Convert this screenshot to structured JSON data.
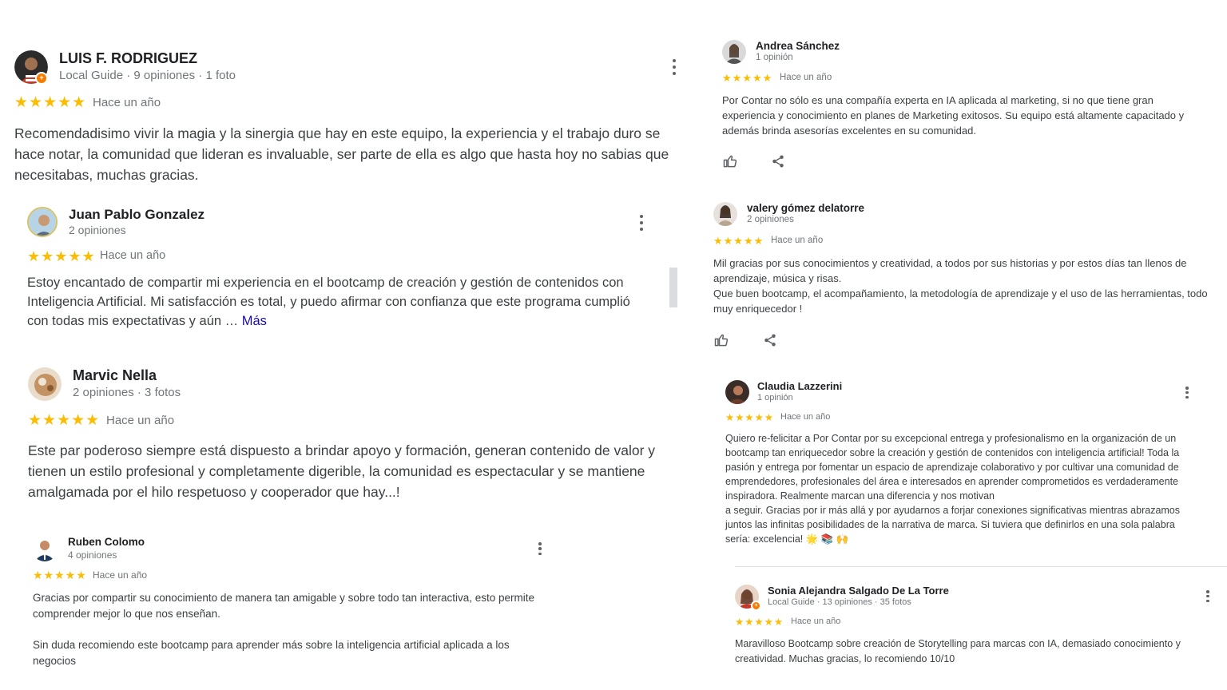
{
  "colors": {
    "star": "#fbbc04",
    "meta": "#70757a",
    "link": "#1a0dab",
    "badge": "#f57c00"
  },
  "icons": {
    "kebab": "more-vert-icon",
    "like": "thumb-up-icon",
    "share": "share-icon",
    "star": "star-icon",
    "local_guide": "local-guide-badge-icon"
  },
  "reviews": [
    {
      "author": "LUIS F. RODRIGUEZ",
      "meta": "Local Guide · 9 opiniones · 1 foto",
      "stars": "★★★★★",
      "rating": 5,
      "time": "Hace un año",
      "text": "Recomendadisimo vivir la magia y la sinergia que hay en este equipo, la experiencia y el trabajo duro se hace notar, la comunidad que lideran es invaluable, ser parte de ella es algo que hasta hoy no sabias que necesitabas, muchas gracias."
    },
    {
      "author": "Juan Pablo Gonzalez",
      "meta": "2 opiniones",
      "stars": "★★★★★",
      "rating": 5,
      "time": "Hace un año",
      "text": "Estoy encantado de compartir mi experiencia en el bootcamp de creación y gestión de contenidos con Inteligencia Artificial. Mi satisfacción es total, y puedo afirmar con confianza que este programa cumplió con todas mis expectativas y aún …",
      "more": "Más"
    },
    {
      "author": "Marvic Nella",
      "meta": "2 opiniones · 3 fotos",
      "stars": "★★★★★",
      "rating": 5,
      "time": "Hace un año",
      "text": "Este par poderoso siempre está dispuesto a brindar apoyo y formación, generan contenido de valor y tienen un estilo profesional y completamente digerible, la comunidad es espectacular y se mantiene amalgamada por el hilo respetuoso y cooperador que hay...!"
    },
    {
      "author": "Ruben Colomo",
      "meta": "4 opiniones",
      "stars": "★★★★★",
      "rating": 5,
      "time": "Hace un año",
      "text": "Gracias por compartir su conocimiento de manera tan amigable y sobre todo tan interactiva, esto permite comprender mejor lo que nos enseñan.",
      "text2": "Sin duda recomiendo este bootcamp para aprender más sobre la inteligencia artificial aplicada a los negocios"
    },
    {
      "author": "Andrea Sánchez",
      "meta": "1 opinión",
      "stars": "★★★★★",
      "rating": 5,
      "time": "Hace un año",
      "text": "Por Contar no sólo es una compañía experta en IA aplicada al marketing, si no que tiene gran experiencia y conocimiento en planes de Marketing exitosos. Su equipo está altamente capacitado y además brinda asesorías excelentes en su comunidad."
    },
    {
      "author": "valery gómez delatorre",
      "meta": "2 opiniones",
      "stars": "★★★★★",
      "rating": 5,
      "time": "Hace un año",
      "text": "Mil gracias por sus conocimientos y creatividad, a todos por sus historias y por estos días tan llenos de aprendizaje, música y risas.",
      "text2": "Que buen bootcamp, el acompañamiento, la metodología de aprendizaje y el uso de las herramientas, todo muy enriquecedor !"
    },
    {
      "author": "Claudia Lazzerini",
      "meta": "1 opinión",
      "stars": "★★★★★",
      "rating": 5,
      "time": "Hace un año",
      "text": "Quiero re-felicitar a Por Contar por su excepcional entrega y profesionalismo en la organización de un bootcamp tan enriquecedor sobre la creación y gestión de contenidos con inteligencia artificial! Toda la pasión y entrega por fomentar un espacio de aprendizaje colaborativo y por cultivar una comunidad de emprendedores, profesionales del área e interesados en aprender comprometidos es verdaderamente inspiradora. Realmente marcan una diferencia y nos motivan",
      "text2": "a seguir. Gracias por ir más allá y por ayudarnos a forjar conexiones significativas mientras abrazamos juntos las infinitas posibilidades de la narrativa de marca. Si tuviera que definirlos en una sola palabra sería: excelencia! 🌟 📚 🙌"
    },
    {
      "author": "Sonia Alejandra Salgado De La Torre",
      "meta": "Local Guide · 13 opiniones · 35 fotos",
      "stars": "★★★★★",
      "rating": 5,
      "time": "Hace un año",
      "text": "Maravilloso Bootcamp sobre creación de Storytelling para marcas con IA, demasiado conocimiento y creatividad. Muchas gracias, lo recomiendo 10/10"
    }
  ]
}
